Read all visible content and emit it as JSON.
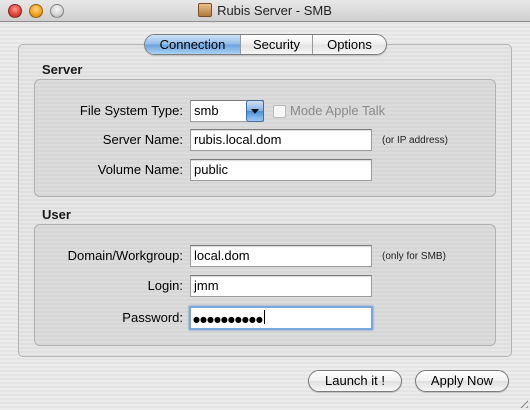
{
  "window": {
    "title": "Rubis Server - SMB",
    "icon": "server-app-icon"
  },
  "tabs": [
    {
      "label": "Connection",
      "active": true
    },
    {
      "label": "Security",
      "active": false
    },
    {
      "label": "Options",
      "active": false
    }
  ],
  "server": {
    "section_title": "Server",
    "fs_type_label": "File System Type:",
    "fs_type_value": "smb",
    "apple_talk_label": "Mode Apple Talk",
    "apple_talk_checked": false,
    "server_name_label": "Server Name:",
    "server_name_value": "rubis.local.dom",
    "server_name_hint": "(or IP address)",
    "volume_name_label": "Volume Name:",
    "volume_name_value": "public"
  },
  "user": {
    "section_title": "User",
    "domain_label": "Domain/Workgroup:",
    "domain_value": "local.dom",
    "domain_hint": "(only for SMB)",
    "login_label": "Login:",
    "login_value": "jmm",
    "password_label": "Password:",
    "password_value": "●●●●●●●●●●"
  },
  "buttons": {
    "launch": "Launch it !",
    "apply": "Apply Now"
  },
  "colors": {
    "accent": "#6aa3de",
    "focus_ring": "#79a7db"
  }
}
